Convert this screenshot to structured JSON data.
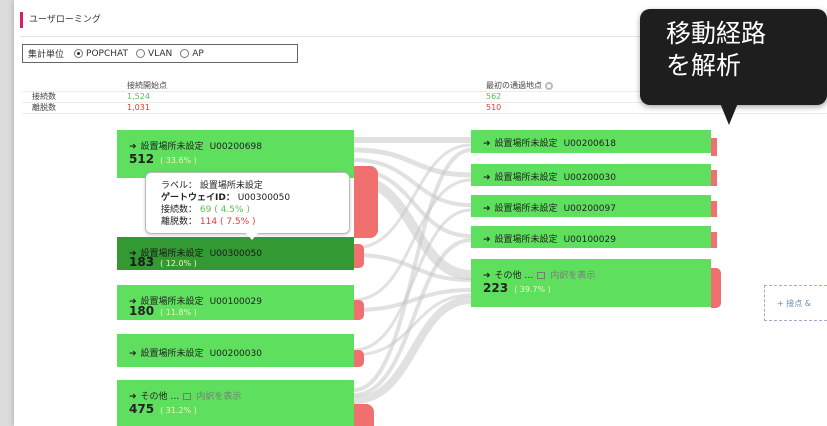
{
  "page": {
    "title": "ユーザローミング"
  },
  "aggregation": {
    "label": "集計単位",
    "options": [
      "POPCHAT",
      "VLAN",
      "AP"
    ],
    "selected": "POPCHAT"
  },
  "stats": {
    "col_start": "接続開始点",
    "col_first": "最初の通過地点",
    "connections_label": "接続数",
    "disconnections_label": "離脱数",
    "start_connections": "1,524",
    "start_disconnections": "1,031",
    "first_connections": "562",
    "first_disconnections": "510"
  },
  "left_nodes": [
    {
      "arrow": "➜",
      "label": "設置場所未設定",
      "id": "U00200698",
      "count": "512",
      "pct": "( 33.6% )"
    },
    {
      "arrow": "➜",
      "label": "設置場所未設定",
      "id": "U00300050",
      "count": "183",
      "pct": "( 12.0% )"
    },
    {
      "arrow": "➜",
      "label": "設置場所未設定",
      "id": "U00100029",
      "count": "180",
      "pct": "( 11.8% )"
    },
    {
      "arrow": "➜",
      "label": "設置場所未設定",
      "id": "U00200030"
    },
    {
      "arrow": "➜",
      "label": "その他 …",
      "detail": "内訳を表示",
      "count": "475",
      "pct": "( 31.2% )"
    }
  ],
  "right_nodes": [
    {
      "arrow": "➜",
      "label": "設置場所未設定",
      "id": "U00200618"
    },
    {
      "arrow": "➜",
      "label": "設置場所未設定",
      "id": "U00200030"
    },
    {
      "arrow": "➜",
      "label": "設置場所未設定",
      "id": "U00200097"
    },
    {
      "arrow": "➜",
      "label": "設置場所未設定",
      "id": "U00100029"
    },
    {
      "arrow": "➜",
      "label": "その他 …",
      "detail": "内訳を表示",
      "count": "223",
      "pct": "( 39.7% )"
    }
  ],
  "tooltip": {
    "label_key": "ラベル：",
    "label_val": "設置場所未設定",
    "gateway_key": "ゲートウェイID：",
    "gateway_val": "U00300050",
    "conn_key": "接続数：",
    "conn_val": "69",
    "conn_pct": "( 4.5% )",
    "disc_key": "離脱数：",
    "disc_val": "114",
    "disc_pct": "( 7.5% )"
  },
  "add_point": "+ 接点 &",
  "callout": {
    "line1": "移動経路",
    "line2": "を解析"
  },
  "colors": {
    "accent": "#d6206b",
    "node": "#5ee05e",
    "node_selected": "#339933",
    "disconnect": "#f07070"
  }
}
